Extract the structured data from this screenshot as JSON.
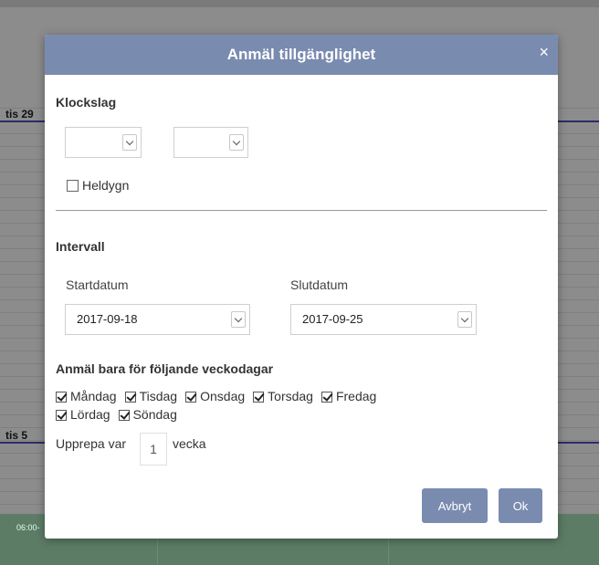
{
  "background": {
    "days": [
      {
        "label": "tis 29"
      },
      {
        "label": "tis 5"
      }
    ],
    "time_label": "06:00-"
  },
  "modal": {
    "title": "Anmäl tillgänglighet",
    "close_label": "×",
    "time_section": {
      "title": "Klockslag",
      "from_value": "",
      "to_value": "",
      "allday_label": "Heldygn",
      "allday_checked": false
    },
    "interval_section": {
      "title": "Intervall",
      "start_label": "Startdatum",
      "start_value": "2017-09-18",
      "end_label": "Slutdatum",
      "end_value": "2017-09-25"
    },
    "weekdays_section": {
      "title": "Anmäl bara för följande veckodagar",
      "days": [
        {
          "label": "Måndag",
          "checked": true
        },
        {
          "label": "Tisdag",
          "checked": true
        },
        {
          "label": "Onsdag",
          "checked": true
        },
        {
          "label": "Torsdag",
          "checked": true
        },
        {
          "label": "Fredag",
          "checked": true
        },
        {
          "label": "Lördag",
          "checked": true
        },
        {
          "label": "Söndag",
          "checked": true
        }
      ]
    },
    "repeat": {
      "prefix": "Upprepa var",
      "value": "1",
      "unit": "vecka"
    },
    "buttons": {
      "cancel": "Avbryt",
      "ok": "Ok"
    }
  },
  "colors": {
    "header": "#7a8bb0",
    "button": "#7a8bb0",
    "overlay": "#8c8c8c"
  }
}
